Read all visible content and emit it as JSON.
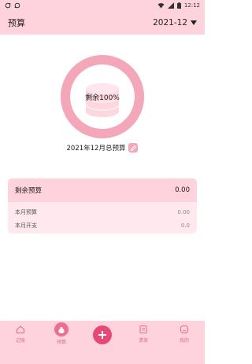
{
  "status_bar": {
    "time": "12:12"
  },
  "header": {
    "title": "预算",
    "month": "2021-12"
  },
  "ring": {
    "label": "剩余100%",
    "remaining_fraction": 1.0
  },
  "budget_title": "2021年12月总预算",
  "card": {
    "remaining_label": "剩余预算",
    "remaining_value": "0.00",
    "rows": [
      {
        "label": "本月预算",
        "value": "0.00"
      },
      {
        "label": "本月开支",
        "value": "0.0"
      }
    ]
  },
  "nav": {
    "items": [
      {
        "label": "记账"
      },
      {
        "label": "预算"
      },
      {
        "label": ""
      },
      {
        "label": "清单"
      },
      {
        "label": "我的"
      }
    ]
  },
  "colors": {
    "accent": "#e74876",
    "pink_light": "#ffd3dd",
    "ring": "#f4a7b9"
  }
}
